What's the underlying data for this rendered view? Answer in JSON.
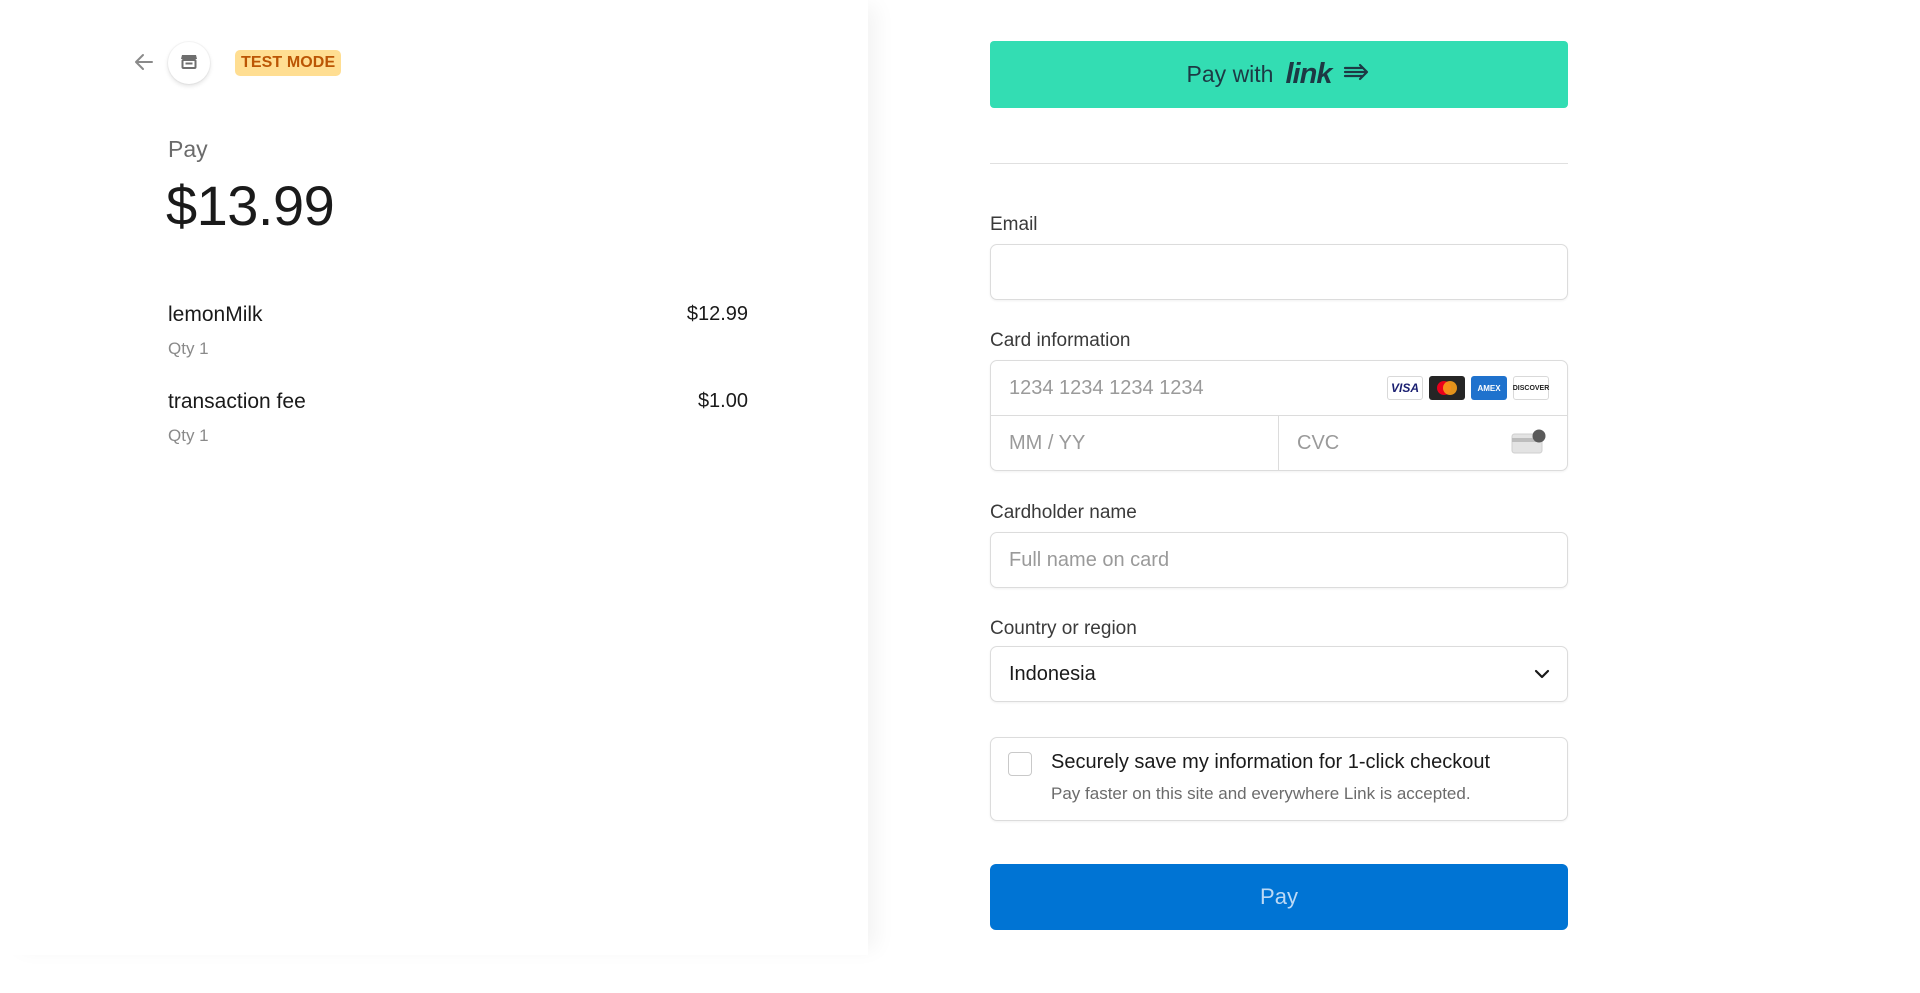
{
  "header": {
    "test_mode_label": "TEST MODE"
  },
  "summary": {
    "pay_label": "Pay",
    "total": "$13.99",
    "items": [
      {
        "name": "lemonMilk",
        "qty": "Qty 1",
        "price": "$12.99"
      },
      {
        "name": "transaction fee",
        "qty": "Qty 1",
        "price": "$1.00"
      }
    ]
  },
  "link_button": {
    "prefix": "Pay with",
    "brand": "link"
  },
  "form": {
    "email_label": "Email",
    "email_value": "",
    "card_label": "Card information",
    "card_number_placeholder": "1234 1234 1234 1234",
    "expiry_placeholder": "MM / YY",
    "cvc_placeholder": "CVC",
    "card_brands": [
      "VISA",
      "Mastercard",
      "AMEX",
      "DISCOVER"
    ],
    "cardholder_label": "Cardholder name",
    "cardholder_placeholder": "Full name on card",
    "country_label": "Country or region",
    "country_value": "Indonesia",
    "save_title": "Securely save my information for 1-click checkout",
    "save_subtitle": "Pay faster on this site and everywhere Link is accepted.",
    "pay_button": "Pay"
  },
  "colors": {
    "link_green": "#33ddb3",
    "pay_blue": "#0074d4",
    "test_badge_bg": "#ffde92",
    "test_badge_text": "#bb5504"
  },
  "icons": [
    "back-arrow-icon",
    "store-icon",
    "link-arrow-icon",
    "cvc-card-icon",
    "chevron-down-icon"
  ]
}
